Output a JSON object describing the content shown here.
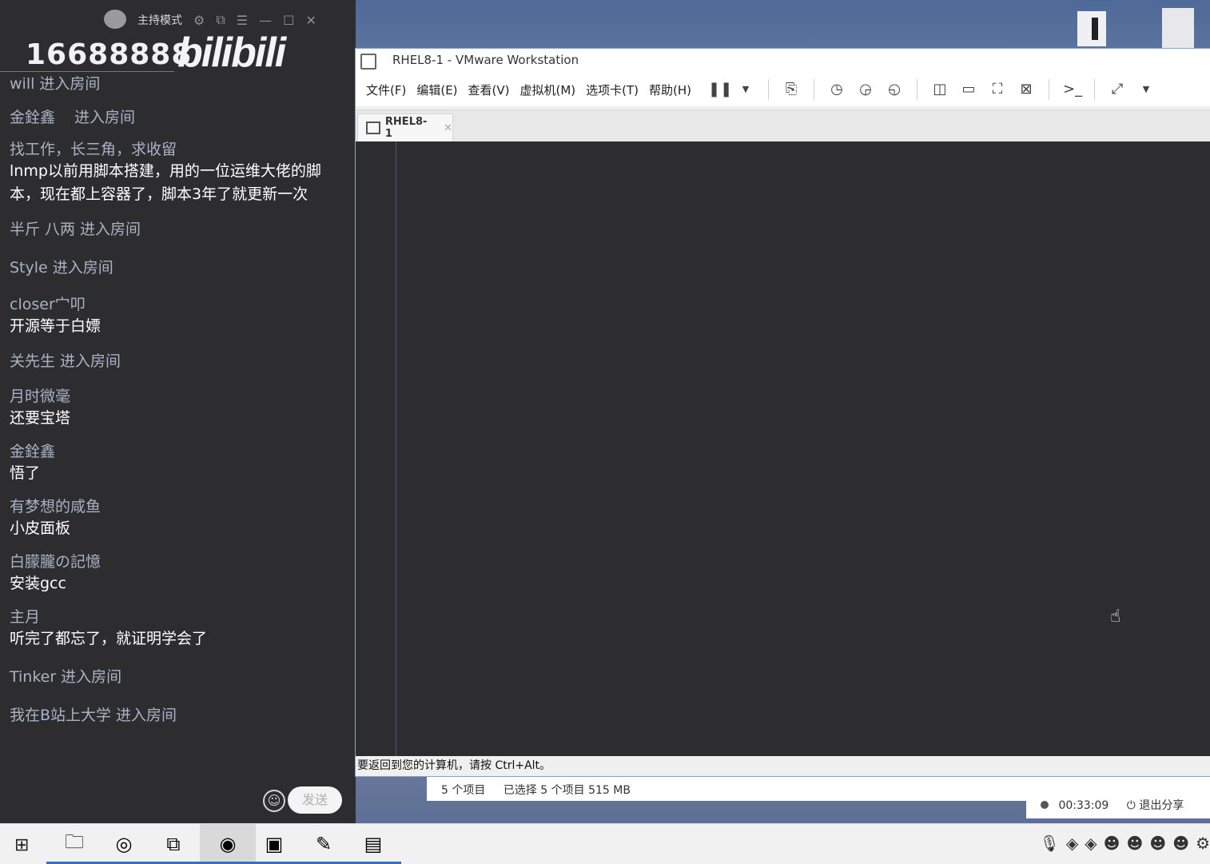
{
  "chat": {
    "mode_label": "主持模式",
    "room_id": "16688888",
    "brand": "bilibili",
    "messages": [
      {
        "type": "enter",
        "name": "will",
        "action": "进入房间"
      },
      {
        "type": "enter",
        "name": "金銓鑫",
        "action": "进入房间"
      },
      {
        "type": "msg",
        "name": "找工作，长三角，求收留",
        "text": "lnmp以前用脚本搭建，用的一位运维大佬的脚本，现在都上容器了，脚本3年了就更新一次"
      },
      {
        "type": "enter",
        "name": "半斤  八两",
        "action": "进入房间"
      },
      {
        "type": "enter",
        "name": "Style",
        "action": "进入房间"
      },
      {
        "type": "msg",
        "name": "closer宀叩",
        "text": "开源等于白嫖"
      },
      {
        "type": "enter",
        "name": "关先生",
        "action": "进入房间"
      },
      {
        "type": "msg",
        "name": "月时微毫",
        "text": "还要宝塔"
      },
      {
        "type": "msg",
        "name": "金銓鑫",
        "text": "悟了"
      },
      {
        "type": "msg",
        "name": "有梦想的咸鱼",
        "text": "小皮面板"
      },
      {
        "type": "msg",
        "name": "白朦朧の記憶",
        "text": "安装gcc"
      },
      {
        "type": "msg",
        "name": "主月",
        "text": "听完了都忘了，就证明学会了"
      },
      {
        "type": "enter",
        "name": "Tinker",
        "action": "进入房间"
      },
      {
        "type": "enter",
        "name": "我在B站上大学",
        "action": "进入房间"
      }
    ],
    "send_label": "发送"
  },
  "vmware": {
    "title": "RHEL8-1 - VMware Workstation",
    "menu": [
      "文件(F)",
      "编辑(E)",
      "查看(V)",
      "虚拟机(M)",
      "选项卡(T)",
      "帮助(H)"
    ],
    "tab_label": "RHEL8-1",
    "status_hint": "要返回到您的计算机，请按 Ctrl+Alt。"
  },
  "explorer": {
    "items_count": "5 个项目",
    "selected": "已选择 5 个项目  515 MB"
  },
  "share": {
    "timer": "00:33:09",
    "exit_label": "退出分享"
  },
  "taskbar": {
    "apps": [
      "file-explorer-icon",
      "chrome-icon",
      "vmware-icon",
      "bilibili-icon",
      "xshell-icon",
      "notepad-icon",
      "monitor-icon"
    ]
  }
}
